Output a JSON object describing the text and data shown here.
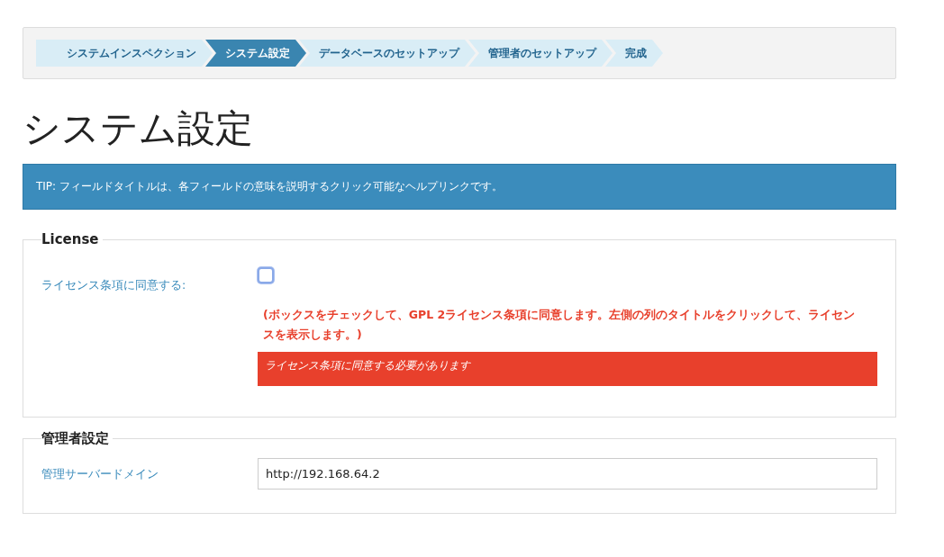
{
  "steps": [
    {
      "label": "システムインスペクション",
      "selected": false
    },
    {
      "label": "システム設定",
      "selected": true
    },
    {
      "label": "データベースのセットアップ",
      "selected": false
    },
    {
      "label": "管理者のセットアップ",
      "selected": false
    },
    {
      "label": "完成",
      "selected": false
    }
  ],
  "title": "システム設定",
  "tip": "TIP: フィールドタイトルは、各フィールドの意味を説明するクリック可能なヘルプリンクです。",
  "license": {
    "legend": "License",
    "label": "ライセンス条項に同意する:",
    "checked": false,
    "hint": "(ボックスをチェックして、GPL 2ライセンス条項に同意します。左側の列のタイトルをクリックして、ライセンスを表示します。)",
    "error": "ライセンス条項に同意する必要があります"
  },
  "admin": {
    "legend": "管理者設定",
    "label": "管理サーバードメイン",
    "value": "http://192.168.64.2"
  }
}
